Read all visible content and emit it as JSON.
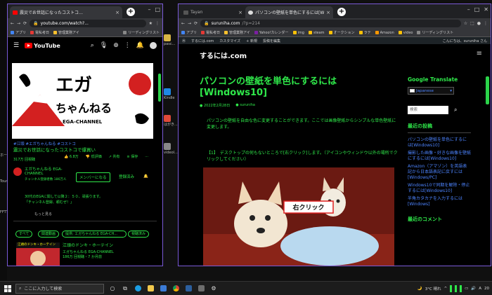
{
  "desktop": {
    "icons": [
      {
        "label": "pasc..."
      },
      {
        "label": "Kindle"
      },
      {
        "label": "はがき..."
      },
      {
        "label": "videol..."
      }
    ],
    "left_labels": [
      "ホーム",
      "Tour",
      "FFTT"
    ]
  },
  "window_youtube": {
    "tabs": [
      {
        "label": "震災でお世話になったコストコ…",
        "close": "×"
      }
    ],
    "new_tab": "+",
    "address": "youtube.com/watch?...",
    "bookmarks": [
      "アプリ",
      "電私考日",
      "管理業務アイ",
      "リーディングリスト"
    ],
    "youtube": {
      "logo_text": "YouTube",
      "thumbnail_title_jp": "エガ",
      "thumbnail_subtitle": "ちゃんねる",
      "thumbnail_en": "EGA-CHANNEL",
      "hashtags": "#江頭 #エガちゃんねる #コストコ",
      "video_title": "震災でお世話になったコストコで爆買い",
      "views": "317万 回視聴",
      "like_count": "6.8万",
      "dislike_label": "低評価",
      "share_label": "共有",
      "save_label": "保存",
      "channel_name": "エガちゃんねる EGA-CHANNEL",
      "subscribers": "チャンネル登録者数 186万人",
      "member_button": "メンバーになる",
      "subscribe_button": "登録済み",
      "description_1": "30代のEGAに関して以降２：５０、頑張ります。",
      "description_2": "「チャンネル登録、頼むぜ！」",
      "more_label": "もっと見る",
      "chips": [
        "すべて",
        "関連動画",
        "提供: エガちゃんねる EGA-CH...",
        "視聴済み"
      ],
      "next_video_title": "江頭のドンキ・ホーテイン",
      "next_video_channel": "エガちゃんねる EGA-CHANNEL",
      "next_video_meta": "186万 回視聴・7 か月前"
    }
  },
  "window_site": {
    "tabs": [
      {
        "label": "Tayan",
        "close": "×"
      },
      {
        "label": "パソコンの壁紙を単色にするには[Wi...",
        "close": "×"
      }
    ],
    "new_tab": "+",
    "address_domain": "suruniha.com",
    "address_path": "/?p=214",
    "bookmarks": [
      "アプリ",
      "電私考日",
      "管理業務アイ",
      "Yahoo!カレンダー",
      "img",
      "steam",
      "オークション",
      "ラテ",
      "Amazon",
      "video",
      "リーディングリスト"
    ],
    "wp_bar": [
      "するには.com",
      "カスタマイズ",
      "新規",
      "投稿を編集"
    ],
    "wp_greeting": "こんにちは、suruniha さん",
    "site_title": "するには.com",
    "article": {
      "title": "パソコンの壁紙を単色にするには[Windows10]",
      "date": "2022年2月28日",
      "author": "suruniha",
      "intro": "パソコンの壁紙を自由な色に変更することができます。ここでは画像壁紙からシンプルな単色壁紙に変更します。",
      "step": "【1】　デスクトップの何もないところで[右クリック]します。（アイコンやウィンドウ以外の場所でクリックしてください）",
      "photo_label": "右クリック"
    },
    "sidebar": {
      "translate_title": "Google Translate",
      "language": "Japanese",
      "search_placeholder": "検索",
      "recent_title": "最近の投稿",
      "recent_posts": [
        "パソコンの壁紙を単色にするには[Windows10]",
        "撮影した画像・好きな画像を壁紙にするには[Windows10]",
        "Amazon（アマゾン）を英語表記から日本語表記に戻すには[Windows/PC]",
        "Windows10で同期を解除・停止するには[Windows10]",
        "半角カタカナを入力するには[Windows]"
      ],
      "comments_title": "最近のコメント"
    }
  },
  "taskbar": {
    "search_placeholder": "ここに入力して検索",
    "weather": "3°C 晴れ",
    "ime": "A",
    "time_hint": "20"
  },
  "colors": {
    "accent_green": "#2fe84a",
    "link_blue": "#4d84ff",
    "window_border": "#7a5ad8"
  }
}
